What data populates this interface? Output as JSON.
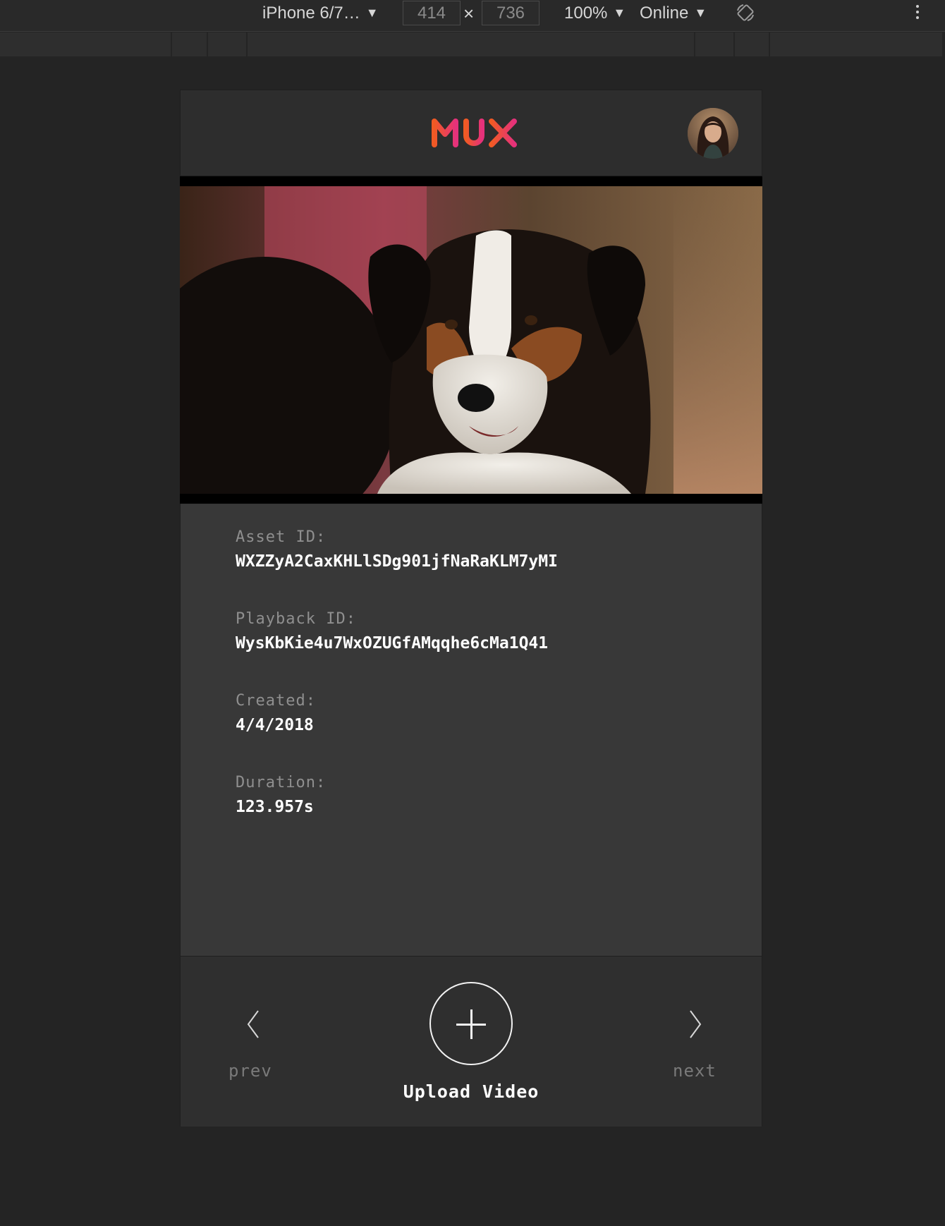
{
  "devtools": {
    "device": "iPhone 6/7…",
    "width": "414",
    "height": "736",
    "times": "×",
    "zoom": "100%",
    "network": "Online"
  },
  "app": {
    "logo": "MUX",
    "colors": {
      "logo_start": "#f15a24",
      "logo_end": "#e5317b"
    }
  },
  "details": [
    {
      "label": "Asset ID:",
      "value": "WXZZyA2CaxKHLlSDg901jfNaRaKLM7yMI"
    },
    {
      "label": "Playback ID:",
      "value": "WysKbKie4u7WxOZUGfAMqqhe6cMa1Q41"
    },
    {
      "label": "Created:",
      "value": "4/4/2018"
    },
    {
      "label": "Duration:",
      "value": "123.957s"
    }
  ],
  "footer": {
    "prev": "prev",
    "next": "next",
    "upload": "Upload Video"
  }
}
